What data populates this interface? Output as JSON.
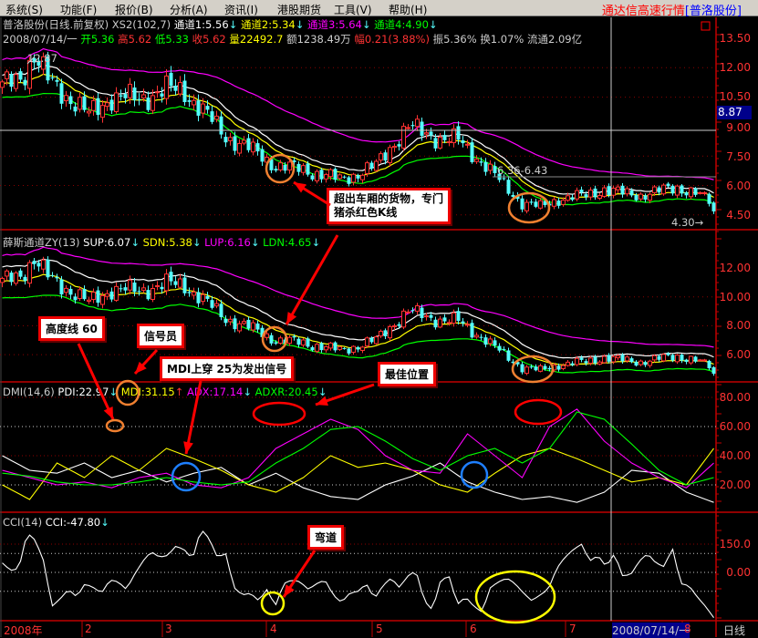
{
  "menu": [
    "系统(S)",
    "功能(F)",
    "报价(B)",
    "分析(A)",
    "资讯(I)",
    "港股期货",
    "工具(V)",
    "帮助(H)"
  ],
  "app_title": {
    "main": "通达信高速行情",
    "stock": "[普洛股份]"
  },
  "header1": {
    "name": "普洛股份(日线.前复权) XS2(102,7)",
    "ch1": "通道1:5.56",
    "ch2": "通道2:5.34",
    "ch3": "通道3:5.64",
    "ch4": "通道4:4.90",
    "arrow": "↓"
  },
  "header2": {
    "date": "2008/07/14/一",
    "open": "开5.36",
    "high": "高5.62",
    "low": "低5.33",
    "close": "收5.62",
    "vol": "量22492.7",
    "amt": "额1238.49万",
    "chg": "幅0.21(3.88%)",
    "amp": "振5.36%",
    "turn": "换1.07%",
    "float": "流通2.09亿"
  },
  "header3": {
    "name": "薛斯通道ZY(13)",
    "sup": "SUP:6.07",
    "sdn": "SDN:5.38",
    "lup": "LUP:6.16",
    "ldn": "LDN:4.65",
    "arrow": "↓"
  },
  "header4": {
    "name": "DMI(14,6)",
    "pdi": "PDI:22.97",
    "mdi": "MDI:31.15",
    "adx": "ADX:17.14",
    "adxr": "ADXR:20.45",
    "up": "↑",
    "down": "↓"
  },
  "header5": {
    "name": "CCI(14)",
    "cci": "CCI:-47.80",
    "arrow": "↓"
  },
  "annotations": {
    "high": "12.87",
    "range": "6.36-6.43",
    "low": "4.30",
    "cursor_price": "8.87",
    "c1": "超出车厢的货物，专门",
    "c1b": "猪杀红色K线",
    "c2": "高度线 60",
    "c3": "信号员",
    "c4": "MDI上穿 25为发出信号",
    "c5": "最佳位置",
    "c6": "弯道"
  },
  "axes": {
    "p1": [
      "13.50",
      "12.00",
      "10.50",
      "9.00",
      "7.50",
      "6.00",
      "4.50"
    ],
    "p2": [
      "12.00",
      "10.00",
      "8.00",
      "6.00"
    ],
    "p3": [
      "80.00",
      "60.00",
      "40.00",
      "20.00"
    ],
    "p4": [
      "150.0",
      "0.00"
    ]
  },
  "dates": [
    "2008年",
    "2",
    "3",
    "4",
    "5",
    "6",
    "7",
    "2008/07/14/一",
    "8",
    "日线"
  ],
  "colors": {
    "up": "#ff3232",
    "down": "#54fcfc",
    "ch_top": "#ff00ff",
    "ch_mid": "#ffffff",
    "ch_yel": "#ffff00",
    "ch_low": "#00ff00",
    "axis": "#c00000"
  },
  "chart_data": [
    {
      "type": "candlestick",
      "title": "普洛股份(日线.前复权)",
      "ylim": [
        4.3,
        13.8
      ],
      "count": 157,
      "close_keypoints": [
        [
          0,
          11.0
        ],
        [
          4,
          11.5
        ],
        [
          7,
          12.6
        ],
        [
          10,
          11.4
        ],
        [
          14,
          10.6
        ],
        [
          19,
          9.6
        ],
        [
          24,
          10.5
        ],
        [
          30,
          10.4
        ],
        [
          36,
          10.9
        ],
        [
          40,
          10.8
        ],
        [
          44,
          9.8
        ],
        [
          49,
          8.5
        ],
        [
          54,
          7.9
        ],
        [
          60,
          7.0
        ],
        [
          66,
          6.8
        ],
        [
          74,
          6.3
        ],
        [
          78,
          6.6
        ],
        [
          82,
          7.0
        ],
        [
          86,
          8.2
        ],
        [
          89,
          9.0
        ],
        [
          92,
          8.7
        ],
        [
          96,
          8.4
        ],
        [
          100,
          8.3
        ],
        [
          106,
          7.0
        ],
        [
          110,
          6.0
        ],
        [
          114,
          5.1
        ],
        [
          118,
          4.9
        ],
        [
          122,
          5.3
        ],
        [
          128,
          5.5
        ],
        [
          132,
          5.8
        ],
        [
          136,
          5.6
        ],
        [
          140,
          5.5
        ],
        [
          144,
          5.7
        ],
        [
          148,
          5.9
        ],
        [
          152,
          5.6
        ],
        [
          155,
          5.2
        ],
        [
          156,
          4.6
        ]
      ]
    },
    {
      "type": "line",
      "title": "薛斯通道ZY(13)",
      "ylim": [
        3.5,
        14.2
      ]
    },
    {
      "type": "line",
      "title": "DMI(14,6)",
      "ylim": [
        0,
        90
      ],
      "guides": [
        60,
        20
      ],
      "series": [
        {
          "name": "PDI",
          "color": "#ffffff",
          "values": [
            40,
            30,
            28,
            35,
            25,
            30,
            22,
            28,
            32,
            20,
            28,
            18,
            12,
            10,
            20,
            26,
            35,
            22,
            15,
            10,
            12,
            8,
            15,
            30,
            28,
            15,
            8
          ]
        },
        {
          "name": "MDI",
          "color": "#ffff00",
          "values": [
            20,
            10,
            35,
            25,
            40,
            30,
            45,
            38,
            30,
            20,
            15,
            25,
            40,
            32,
            35,
            30,
            20,
            15,
            28,
            40,
            45,
            38,
            30,
            22,
            25,
            20,
            45
          ]
        },
        {
          "name": "ADX",
          "color": "#ff00ff",
          "values": [
            30,
            25,
            20,
            22,
            18,
            25,
            28,
            20,
            18,
            25,
            45,
            55,
            65,
            58,
            40,
            30,
            28,
            55,
            40,
            25,
            60,
            72,
            50,
            35,
            25,
            18,
            35
          ]
        },
        {
          "name": "ADXR",
          "color": "#00ff00",
          "values": [
            28,
            26,
            22,
            20,
            20,
            22,
            25,
            22,
            20,
            22,
            35,
            45,
            58,
            60,
            50,
            38,
            30,
            40,
            45,
            35,
            45,
            70,
            65,
            48,
            30,
            20,
            25
          ]
        }
      ]
    },
    {
      "type": "line",
      "title": "CCI(14)",
      "ylim": [
        -250,
        314
      ],
      "guides": [
        150,
        100,
        0,
        -100
      ],
      "series": [
        {
          "name": "CCI",
          "color": "#ffffff",
          "values": [
            50,
            10,
            20,
            210,
            170,
            60,
            -180,
            -140,
            -90,
            -130,
            -60,
            -80,
            -110,
            -40,
            -50,
            -90,
            -10,
            60,
            110,
            80,
            90,
            140,
            120,
            70,
            230,
            180,
            80,
            100,
            -80,
            -120,
            -110,
            -150,
            -90,
            -180,
            -60,
            -40,
            -50,
            -90,
            -60,
            -40,
            -120,
            -160,
            -110,
            -100,
            -60,
            -140,
            -70,
            -30,
            -80,
            -20,
            10,
            -150,
            -200,
            -40,
            -20,
            -170,
            -130,
            -180,
            -210,
            -80,
            -50,
            -30,
            -60,
            -110,
            -150,
            -120,
            -90,
            20,
            80,
            120,
            150,
            60,
            90,
            30,
            100,
            -20,
            -10,
            60,
            100,
            50,
            30,
            130,
            -60,
            -70,
            -130,
            -180,
            -240
          ]
        }
      ]
    }
  ]
}
